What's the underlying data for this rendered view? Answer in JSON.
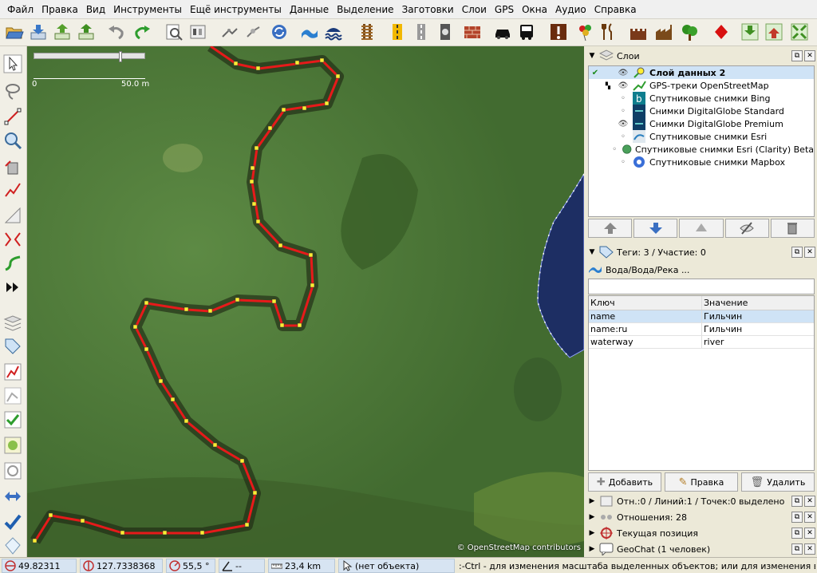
{
  "menu": [
    "Файл",
    "Правка",
    "Вид",
    "Инструменты",
    "Ещё инструменты",
    "Данные",
    "Выделение",
    "Заготовки",
    "Слои",
    "GPS",
    "Окна",
    "Аудио",
    "Справка"
  ],
  "toolbar_icons": [
    "open-icon",
    "download-icon",
    "upload-icon",
    "save-icon",
    "undo-icon",
    "redo-icon",
    "preferences-icon",
    "properties-icon",
    "satellite-icon",
    "node-icon",
    "refresh-icon",
    "waterway-icon",
    "water-icon",
    "railway-icon",
    "road-icon",
    "road-grey-icon",
    "traffic-icon",
    "wall-icon",
    "car-icon",
    "bus-icon",
    "info-icon",
    "party-icon",
    "food-icon",
    "castle-icon",
    "factory-icon",
    "tree-icon",
    "poi-icon",
    "download-area-icon",
    "upload-area-icon",
    "zoom-fit-icon"
  ],
  "scale": {
    "zero": "0",
    "max": "50.0 m"
  },
  "attribution": "© OpenStreetMap contributors",
  "layers_panel": {
    "title": "Слои",
    "items": [
      {
        "name": "Слой данных 2",
        "active": true,
        "visible": true
      },
      {
        "name": "GPS-треки OpenStreetMap",
        "active": false,
        "visible": true
      },
      {
        "name": "Спутниковые снимки Bing",
        "active": false,
        "visible": false
      },
      {
        "name": "Снимки DigitalGlobe Standard",
        "active": false,
        "visible": false
      },
      {
        "name": "Снимки DigitalGlobe Premium",
        "active": false,
        "visible": true
      },
      {
        "name": "Спутниковые снимки Esri",
        "active": false,
        "visible": false
      },
      {
        "name": "Спутниковые снимки Esri (Clarity) Beta",
        "active": false,
        "visible": false
      },
      {
        "name": "Спутниковые снимки Mapbox",
        "active": false,
        "visible": false
      }
    ]
  },
  "tags_panel": {
    "title": "Теги: 3 / Участие: 0",
    "preset": "Вода/Вода/Река ...",
    "col_key": "Ключ",
    "col_value": "Значение",
    "rows": [
      {
        "key": "name",
        "value": "Гильчин",
        "selected": true
      },
      {
        "key": "name:ru",
        "value": "Гильчин",
        "selected": false
      },
      {
        "key": "waterway",
        "value": "river",
        "selected": false
      }
    ],
    "btn_add": "Добавить",
    "btn_edit": "Правка",
    "btn_delete": "Удалить"
  },
  "collapsed_panels": [
    "Отн.:0 / Линий:1 / Точек:0 выделено",
    "Отношения: 28",
    "Текущая позиция",
    "GeoChat (1 человек)"
  ],
  "status": {
    "lat": "49.82311",
    "lon": "127.7338368",
    "heading": "55,5 °",
    "angle": "--",
    "distance": "23,4 km",
    "object": "(нет объекта)",
    "hint": ":-Ctrl - для изменения масштаба выделенных объектов; или для изменения выделения"
  },
  "colors": {
    "river_track": "#e61a1a",
    "node": "#ffee33",
    "water": "#2d3f8a",
    "selection": "#cfe3f6"
  }
}
